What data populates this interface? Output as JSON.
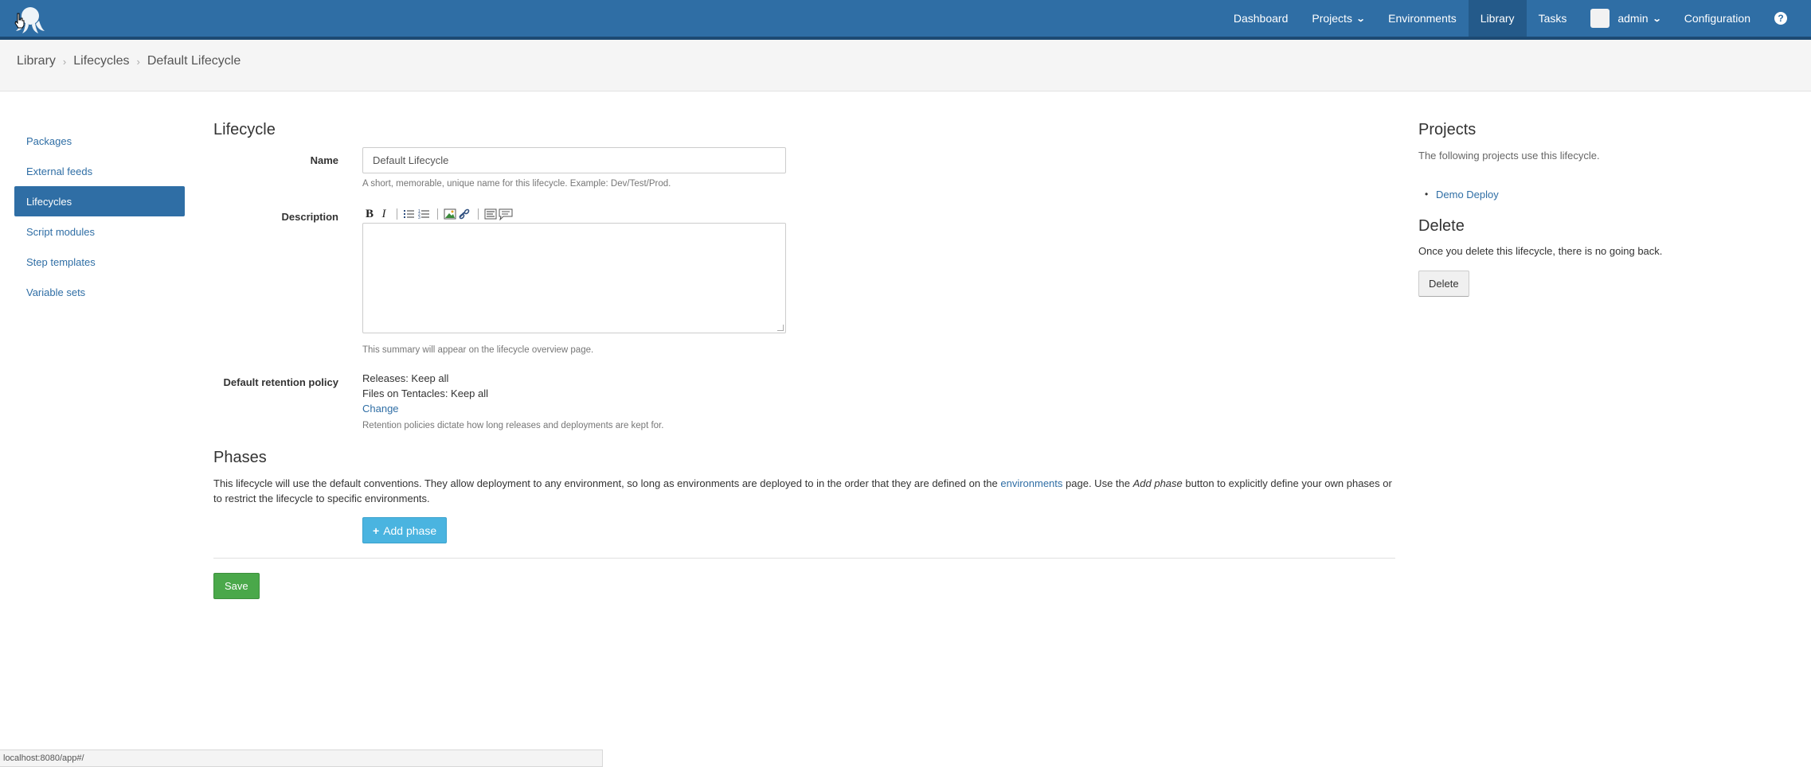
{
  "nav": {
    "items": [
      {
        "label": "Dashboard"
      },
      {
        "label": "Projects"
      },
      {
        "label": "Environments"
      },
      {
        "label": "Library"
      },
      {
        "label": "Tasks"
      },
      {
        "label": "admin"
      },
      {
        "label": "Configuration"
      }
    ],
    "help_label": "?"
  },
  "breadcrumb": [
    "Library",
    "Lifecycles",
    "Default Lifecycle"
  ],
  "sidebar": {
    "items": [
      {
        "label": "Packages"
      },
      {
        "label": "External feeds"
      },
      {
        "label": "Lifecycles"
      },
      {
        "label": "Script modules"
      },
      {
        "label": "Step templates"
      },
      {
        "label": "Variable sets"
      }
    ]
  },
  "form": {
    "title": "Lifecycle",
    "name_label": "Name",
    "name_value": "Default Lifecycle",
    "name_help": "A short, memorable, unique name for this lifecycle. Example: Dev/Test/Prod.",
    "description_label": "Description",
    "description_help": "This summary will appear on the lifecycle overview page.",
    "retention_label": "Default retention policy",
    "retention_releases": "Releases: Keep all",
    "retention_files": "Files on Tentacles: Keep all",
    "retention_change": "Change",
    "retention_help": "Retention policies dictate how long releases and deployments are kept for."
  },
  "phases": {
    "title": "Phases",
    "text_part1": "This lifecycle will use the default conventions. They allow deployment to any environment, so long as environments are deployed to in the order that they are defined on the",
    "text_link": "environments",
    "text_part2": "page. Use the",
    "text_em": "Add phase",
    "text_part3": "button to explicitly define your own phases or to restrict the lifecycle to specific environments.",
    "add_button": "Add phase",
    "add_icon": "+"
  },
  "save_button": "Save",
  "right": {
    "projects_title": "Projects",
    "projects_text": "The following projects use this lifecycle.",
    "projects": [
      "Demo Deploy"
    ],
    "delete_title": "Delete",
    "delete_text": "Once you delete this lifecycle, there is no going back.",
    "delete_button": "Delete"
  },
  "statusbar": "localhost:8080/app#/"
}
